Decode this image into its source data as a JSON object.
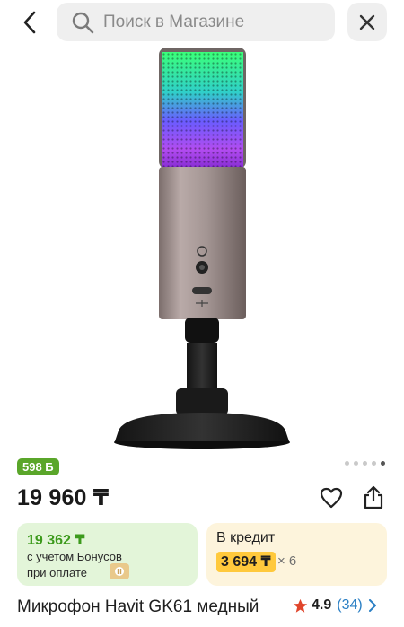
{
  "search": {
    "placeholder": "Поиск в Магазине"
  },
  "product": {
    "bonus_badge": "598 Б",
    "price": "19 960 ₸",
    "title": "Микрофон Havit GK61 медный",
    "rating": "4.9",
    "reviews_count": "(34)",
    "gallery": {
      "total": 5,
      "active_index": 4
    }
  },
  "bonus_card": {
    "price": "19 362 ₸",
    "line1": "с учетом Бонусов",
    "line2": "при оплате"
  },
  "credit_card": {
    "title": "В кредит",
    "amount": "3 694 ₸",
    "times": "× 6"
  },
  "icons": {
    "back": "chevron-left-icon",
    "search": "search-icon",
    "close": "close-icon",
    "favorite": "heart-icon",
    "share": "share-icon",
    "star": "star-icon",
    "forward": "chevron-right-icon"
  },
  "colors": {
    "bonus_badge": "#5aa62a",
    "bonus_card_bg": "#e3f5d9",
    "bonus_price": "#3c9a1c",
    "credit_card_bg": "#fdf4dc",
    "credit_highlight": "#ffc93c",
    "star": "#e0452b",
    "reviews_link": "#2a7fc4"
  }
}
